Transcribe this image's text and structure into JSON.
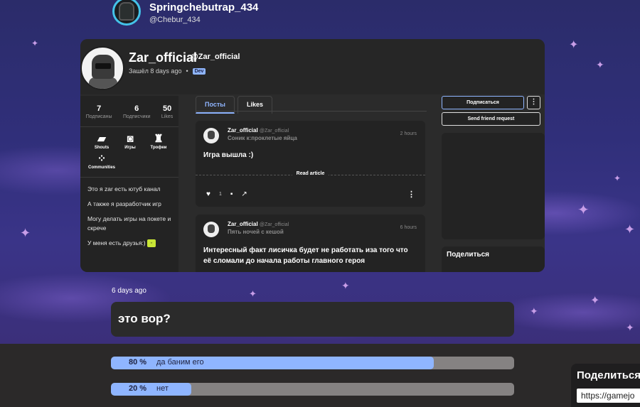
{
  "top_user": {
    "name": "Springchebutrap_434",
    "handle": "@Chebur_434"
  },
  "profile_card": {
    "name": "Zar_official",
    "handle": "@Zar_official",
    "last_seen": "Зашёл 8 days ago",
    "separator": "•",
    "badge": "Dev",
    "stats": [
      {
        "value": "7",
        "label": "Подписаны"
      },
      {
        "value": "6",
        "label": "Подписчики"
      },
      {
        "value": "50",
        "label": "Likes"
      }
    ],
    "nav_icons": [
      {
        "label": "Shouts",
        "icon": "speech-bubble-icon"
      },
      {
        "label": "Игры",
        "icon": "gamepad-icon"
      },
      {
        "label": "Трофеи",
        "icon": "trophy-icon"
      },
      {
        "label": "Communities",
        "icon": "communities-icon"
      }
    ],
    "bio": [
      "Это я zar есть ютуб канал",
      "А также я разработчик игр",
      "Могу делать игры на покете и скрече",
      "У меня есть друзья:)"
    ],
    "tabs": [
      {
        "label": "Посты",
        "active": true
      },
      {
        "label": "Likes",
        "active": false
      }
    ],
    "posts": [
      {
        "author": "Zar_official",
        "handle": "@Zar_official",
        "game": "Соник к:проклетые яйца",
        "time": "2 hours",
        "text": "Игра вышла :)",
        "read_more": "Read article",
        "likes": "1"
      },
      {
        "author": "Zar_official",
        "handle": "@Zar_official",
        "game": "Пять ночей с кешой",
        "time": "6 hours",
        "text": "Интересный факт лисичка будет не работать иза того что её сломали до начала работы главного героя"
      }
    ],
    "subscribe_label": "Подписаться",
    "more_label": "⋮",
    "friend_request_label": "Send friend request",
    "share_label": "Поделиться"
  },
  "poll": {
    "time": "6 days ago",
    "question": "это вор?",
    "options": [
      {
        "percent_label": "80 %",
        "percent": 80,
        "label": "да баним его"
      },
      {
        "percent_label": "20 %",
        "percent": 20,
        "label": "нет"
      }
    ]
  },
  "side_share": {
    "title": "Поделиться",
    "url": "https://gamejo"
  },
  "colors": {
    "accent": "#8fb5ff",
    "avatar_ring": "#44c2e8",
    "card_bg": "#2b2b2b",
    "page_bg": "#2b2929"
  }
}
